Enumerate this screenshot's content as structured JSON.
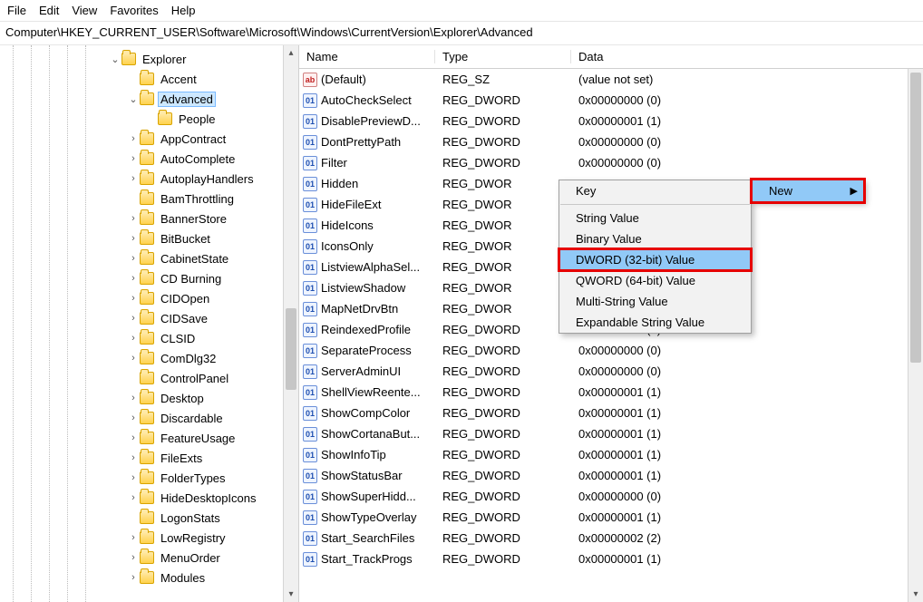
{
  "menubar": [
    "File",
    "Edit",
    "View",
    "Favorites",
    "Help"
  ],
  "address": "Computer\\HKEY_CURRENT_USER\\Software\\Microsoft\\Windows\\CurrentVersion\\Explorer\\Advanced",
  "tree": [
    {
      "depth": 6,
      "twisty": "v",
      "label": "Explorer",
      "sel": false
    },
    {
      "depth": 7,
      "twisty": "",
      "label": "Accent",
      "sel": false
    },
    {
      "depth": 7,
      "twisty": "v",
      "label": "Advanced",
      "sel": true
    },
    {
      "depth": 8,
      "twisty": "",
      "label": "People",
      "sel": false
    },
    {
      "depth": 7,
      "twisty": ">",
      "label": "AppContract",
      "sel": false
    },
    {
      "depth": 7,
      "twisty": ">",
      "label": "AutoComplete",
      "sel": false
    },
    {
      "depth": 7,
      "twisty": ">",
      "label": "AutoplayHandlers",
      "sel": false
    },
    {
      "depth": 7,
      "twisty": "",
      "label": "BamThrottling",
      "sel": false
    },
    {
      "depth": 7,
      "twisty": ">",
      "label": "BannerStore",
      "sel": false
    },
    {
      "depth": 7,
      "twisty": ">",
      "label": "BitBucket",
      "sel": false
    },
    {
      "depth": 7,
      "twisty": ">",
      "label": "CabinetState",
      "sel": false
    },
    {
      "depth": 7,
      "twisty": ">",
      "label": "CD Burning",
      "sel": false
    },
    {
      "depth": 7,
      "twisty": ">",
      "label": "CIDOpen",
      "sel": false
    },
    {
      "depth": 7,
      "twisty": ">",
      "label": "CIDSave",
      "sel": false
    },
    {
      "depth": 7,
      "twisty": ">",
      "label": "CLSID",
      "sel": false
    },
    {
      "depth": 7,
      "twisty": ">",
      "label": "ComDlg32",
      "sel": false
    },
    {
      "depth": 7,
      "twisty": "",
      "label": "ControlPanel",
      "sel": false
    },
    {
      "depth": 7,
      "twisty": ">",
      "label": "Desktop",
      "sel": false
    },
    {
      "depth": 7,
      "twisty": ">",
      "label": "Discardable",
      "sel": false
    },
    {
      "depth": 7,
      "twisty": ">",
      "label": "FeatureUsage",
      "sel": false
    },
    {
      "depth": 7,
      "twisty": ">",
      "label": "FileExts",
      "sel": false
    },
    {
      "depth": 7,
      "twisty": ">",
      "label": "FolderTypes",
      "sel": false
    },
    {
      "depth": 7,
      "twisty": ">",
      "label": "HideDesktopIcons",
      "sel": false
    },
    {
      "depth": 7,
      "twisty": "",
      "label": "LogonStats",
      "sel": false
    },
    {
      "depth": 7,
      "twisty": ">",
      "label": "LowRegistry",
      "sel": false
    },
    {
      "depth": 7,
      "twisty": ">",
      "label": "MenuOrder",
      "sel": false
    },
    {
      "depth": 7,
      "twisty": ">",
      "label": "Modules",
      "sel": false
    }
  ],
  "columns": {
    "name": "Name",
    "type": "Type",
    "data": "Data"
  },
  "values": [
    {
      "icon": "sz",
      "name": "(Default)",
      "type": "REG_SZ",
      "data": "(value not set)"
    },
    {
      "icon": "dw",
      "name": "AutoCheckSelect",
      "type": "REG_DWORD",
      "data": "0x00000000 (0)"
    },
    {
      "icon": "dw",
      "name": "DisablePreviewD...",
      "type": "REG_DWORD",
      "data": "0x00000001 (1)"
    },
    {
      "icon": "dw",
      "name": "DontPrettyPath",
      "type": "REG_DWORD",
      "data": "0x00000000 (0)"
    },
    {
      "icon": "dw",
      "name": "Filter",
      "type": "REG_DWORD",
      "data": "0x00000000 (0)"
    },
    {
      "icon": "dw",
      "name": "Hidden",
      "type": "REG_DWOR",
      "data": ""
    },
    {
      "icon": "dw",
      "name": "HideFileExt",
      "type": "REG_DWOR",
      "data": ""
    },
    {
      "icon": "dw",
      "name": "HideIcons",
      "type": "REG_DWOR",
      "data": ""
    },
    {
      "icon": "dw",
      "name": "IconsOnly",
      "type": "REG_DWOR",
      "data": ""
    },
    {
      "icon": "dw",
      "name": "ListviewAlphaSel...",
      "type": "REG_DWOR",
      "data": ""
    },
    {
      "icon": "dw",
      "name": "ListviewShadow",
      "type": "REG_DWOR",
      "data": ""
    },
    {
      "icon": "dw",
      "name": "MapNetDrvBtn",
      "type": "REG_DWOR",
      "data": ""
    },
    {
      "icon": "dw",
      "name": "ReindexedProfile",
      "type": "REG_DWORD",
      "data": "0x00000001 (1)"
    },
    {
      "icon": "dw",
      "name": "SeparateProcess",
      "type": "REG_DWORD",
      "data": "0x00000000 (0)"
    },
    {
      "icon": "dw",
      "name": "ServerAdminUI",
      "type": "REG_DWORD",
      "data": "0x00000000 (0)"
    },
    {
      "icon": "dw",
      "name": "ShellViewReente...",
      "type": "REG_DWORD",
      "data": "0x00000001 (1)"
    },
    {
      "icon": "dw",
      "name": "ShowCompColor",
      "type": "REG_DWORD",
      "data": "0x00000001 (1)"
    },
    {
      "icon": "dw",
      "name": "ShowCortanaBut...",
      "type": "REG_DWORD",
      "data": "0x00000001 (1)"
    },
    {
      "icon": "dw",
      "name": "ShowInfoTip",
      "type": "REG_DWORD",
      "data": "0x00000001 (1)"
    },
    {
      "icon": "dw",
      "name": "ShowStatusBar",
      "type": "REG_DWORD",
      "data": "0x00000001 (1)"
    },
    {
      "icon": "dw",
      "name": "ShowSuperHidd...",
      "type": "REG_DWORD",
      "data": "0x00000000 (0)"
    },
    {
      "icon": "dw",
      "name": "ShowTypeOverlay",
      "type": "REG_DWORD",
      "data": "0x00000001 (1)"
    },
    {
      "icon": "dw",
      "name": "Start_SearchFiles",
      "type": "REG_DWORD",
      "data": "0x00000002 (2)"
    },
    {
      "icon": "dw",
      "name": "Start_TrackProgs",
      "type": "REG_DWORD",
      "data": "0x00000001 (1)"
    }
  ],
  "context_parent": {
    "label": "New",
    "highlight": true
  },
  "context_sub": [
    {
      "label": "Key",
      "hover": false
    },
    {
      "sep": true
    },
    {
      "label": "String Value",
      "hover": false
    },
    {
      "label": "Binary Value",
      "hover": false
    },
    {
      "label": "DWORD (32-bit) Value",
      "hover": true,
      "redbox": true
    },
    {
      "label": "QWORD (64-bit) Value",
      "hover": false
    },
    {
      "label": "Multi-String Value",
      "hover": false
    },
    {
      "label": "Expandable String Value",
      "hover": false
    }
  ]
}
